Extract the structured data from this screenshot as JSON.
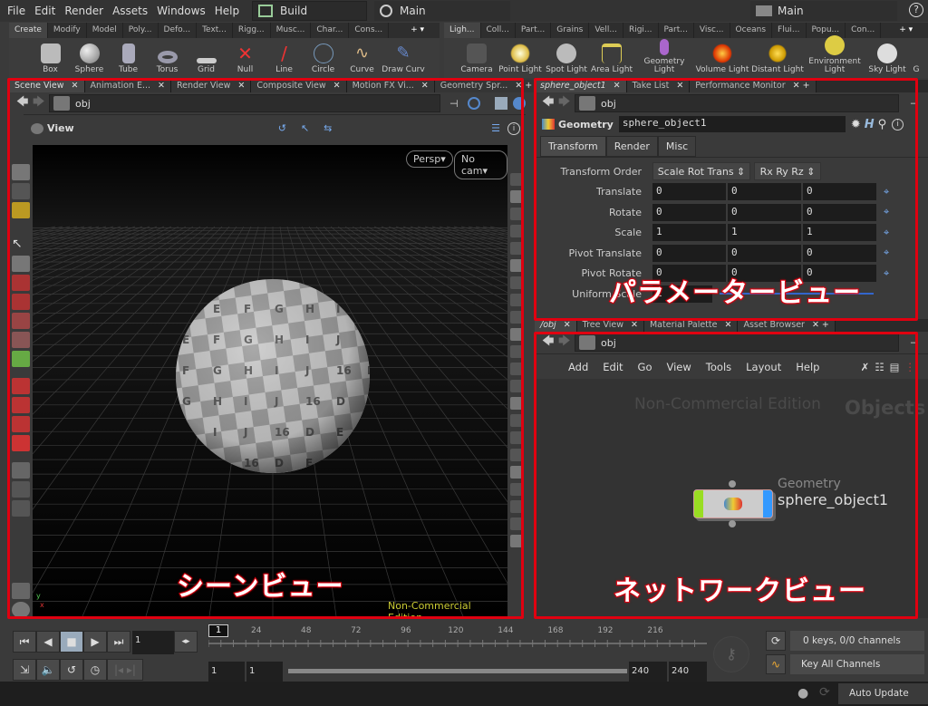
{
  "menu": {
    "items": [
      "File",
      "Edit",
      "Render",
      "Assets",
      "Windows",
      "Help"
    ],
    "desktop": "Build",
    "context": "Main",
    "right_context": "Main",
    "help_icon": "question-icon"
  },
  "shelf_left": {
    "tabs": [
      "Create",
      "Modify",
      "Model",
      "Poly...",
      "Defo...",
      "Text...",
      "Rigg...",
      "Musc...",
      "Char...",
      "Cons..."
    ],
    "tools": [
      "Box",
      "Sphere",
      "Tube",
      "Torus",
      "Grid",
      "Null",
      "Line",
      "Circle",
      "Curve",
      "Draw Curv"
    ]
  },
  "shelf_right": {
    "tabs": [
      "Ligh...",
      "Coll...",
      "Part...",
      "Grains",
      "Vell...",
      "Rigi...",
      "Part...",
      "Visc...",
      "Oceans",
      "Flui...",
      "Popu...",
      "Con..."
    ],
    "tools": [
      "Camera",
      "Point Light",
      "Spot Light",
      "Area Light",
      "Geometry Light",
      "Volume Light",
      "Distant Light",
      "Environment Light",
      "Sky Light",
      "G"
    ]
  },
  "scene": {
    "tabs": [
      "Scene View",
      "Animation E...",
      "Render View",
      "Composite View",
      "Motion FX Vi...",
      "Geometry Spr..."
    ],
    "path": "obj",
    "view_label": "View",
    "persp": "Persp",
    "cam": "No cam",
    "watermark": "Non-Commercial Edition",
    "sphere_letters": [
      "D",
      "E",
      "F",
      "G",
      "H",
      "I",
      "J",
      "16"
    ]
  },
  "params": {
    "tabs": [
      "sphere_object1",
      "Take List",
      "Performance Monitor"
    ],
    "path": "obj",
    "node_type": "Geometry",
    "node_name": "sphere_object1",
    "param_tabs": [
      "Transform",
      "Render",
      "Misc"
    ],
    "transform_order_label": "Transform Order",
    "transform_order": "Scale Rot Trans",
    "rotate_order": "Rx Ry Rz",
    "rows": [
      {
        "label": "Translate",
        "values": [
          "0",
          "0",
          "0"
        ]
      },
      {
        "label": "Rotate",
        "values": [
          "0",
          "0",
          "0"
        ]
      },
      {
        "label": "Scale",
        "values": [
          "1",
          "1",
          "1"
        ]
      },
      {
        "label": "Pivot Translate",
        "values": [
          "0",
          "0",
          "0"
        ]
      },
      {
        "label": "Pivot Rotate",
        "values": [
          "0",
          "0",
          "0"
        ]
      }
    ],
    "uniform_scale_label": "Uniform Scale",
    "uniform_scale": "1"
  },
  "network": {
    "tabs": [
      "/obj",
      "Tree View",
      "Material Palette",
      "Asset Browser"
    ],
    "path": "obj",
    "menu": [
      "Add",
      "Edit",
      "Go",
      "View",
      "Tools",
      "Layout",
      "Help"
    ],
    "watermark": "Non-Commercial Edition",
    "context_label": "Objects",
    "node_type": "Geometry",
    "node_name": "sphere_object1"
  },
  "timeline": {
    "current_frame": "1",
    "ticks": [
      "24",
      "48",
      "72",
      "96",
      "120",
      "144",
      "168",
      "192",
      "216"
    ],
    "range_start": "1",
    "range_start2": "1",
    "range_end": "240",
    "range_end2": "240",
    "keys_info": "0 keys, 0/0 channels",
    "key_all": "Key All Channels",
    "auto_update": "Auto Update"
  },
  "annotations": {
    "scene": "シーンビュー",
    "params": "パラメータービュー",
    "network": "ネットワークビュー",
    "color": "#e00010"
  }
}
